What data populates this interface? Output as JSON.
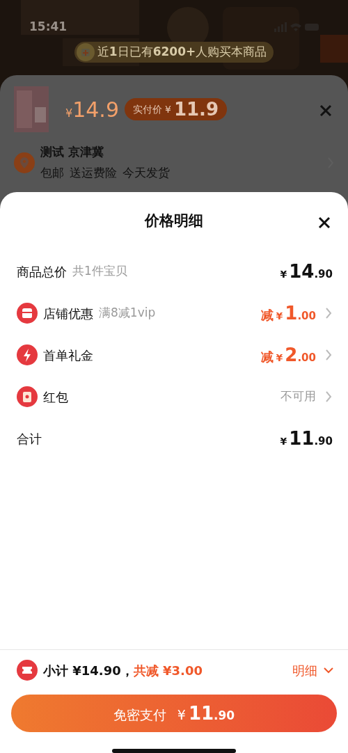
{
  "status_bar": {
    "time": "15:41"
  },
  "banner": {
    "text": "近**1**日已有**6200+**人购买本商品"
  },
  "product_sheet": {
    "price": {
      "currency": "¥",
      "amount": "14.9"
    },
    "paid_badge": {
      "label": "实付价",
      "currency": "¥",
      "amount": "11.9"
    },
    "address": {
      "name": "测试 京津冀",
      "tags": [
        "包邮",
        "送运费险",
        "今天发货"
      ]
    }
  },
  "detail_sheet": {
    "title": "价格明细",
    "rows": [
      {
        "kind": "goods",
        "label": "商品总价",
        "note": "共1件宝贝",
        "currency": "¥",
        "int": "14",
        "dec": ".90"
      },
      {
        "kind": "shop",
        "label": "店铺优惠",
        "note": "满8减1vip",
        "prefix": "减",
        "currency": "¥",
        "int": "1",
        "dec": ".00"
      },
      {
        "kind": "gift",
        "label": "首单礼金",
        "prefix": "减",
        "currency": "¥",
        "int": "2",
        "dec": ".00"
      },
      {
        "kind": "packet",
        "label": "红包",
        "value": "不可用"
      },
      {
        "kind": "total",
        "label": "合计",
        "currency": "¥",
        "int": "11",
        "dec": ".90"
      }
    ]
  },
  "footer": {
    "subtotal": "小计 ¥14.90，",
    "discount": "共减 ¥3.00",
    "detail_toggle": "明细",
    "pay_button": {
      "label": "免密支付",
      "currency": "¥",
      "int": "11",
      "dec": ".90"
    }
  }
}
